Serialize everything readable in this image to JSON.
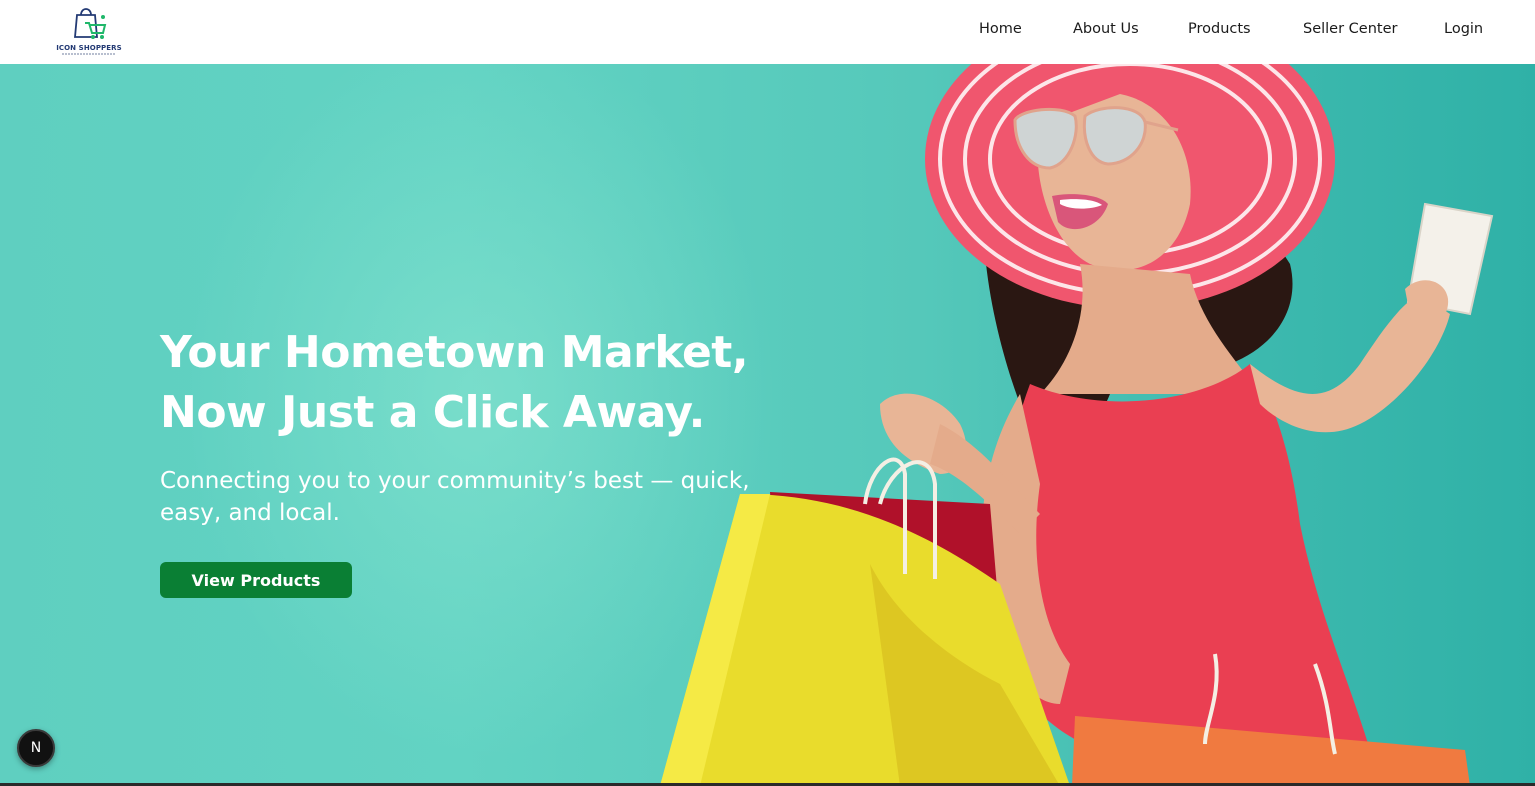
{
  "brand": {
    "name": "ICON SHOPPERS",
    "logo_icon": "shopping-bag-cart-icon",
    "colors": {
      "primary_text": "#233a74",
      "accent": "#1fb76a"
    }
  },
  "nav": {
    "items": [
      {
        "label": "Home"
      },
      {
        "label": "About Us"
      },
      {
        "label": "Products"
      },
      {
        "label": "Seller Center"
      },
      {
        "label": "Login"
      }
    ]
  },
  "hero": {
    "title_line1": "Your Hometown Market,",
    "title_line2": "Now Just a Click Away.",
    "subtitle_line1": "Connecting you to your community’s best — quick,",
    "subtitle_line2": "easy, and local.",
    "cta_label": "View Products",
    "colors": {
      "background": "#5fcfc0",
      "cta": "#0a7f34",
      "text": "#ffffff"
    }
  },
  "dev_badge": {
    "label": "N",
    "icon": "nextjs-icon"
  }
}
